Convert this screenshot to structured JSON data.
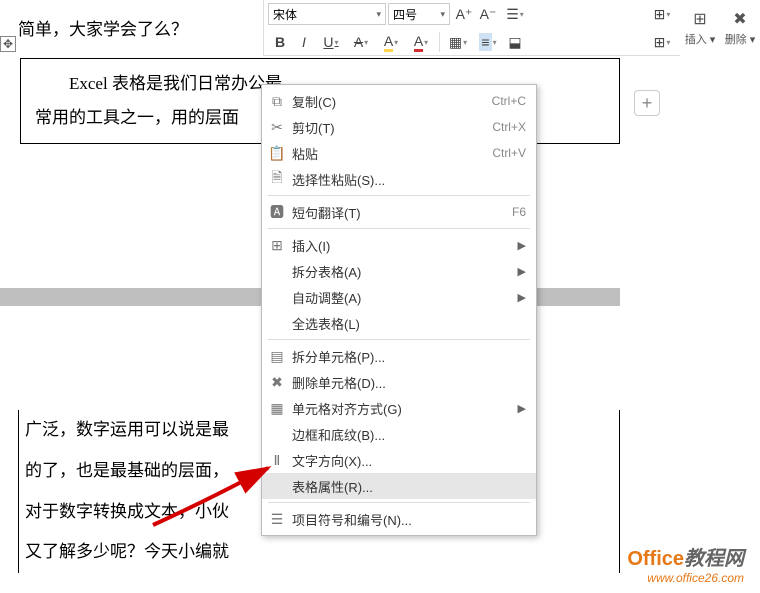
{
  "toolbar": {
    "font_family": "宋体",
    "font_size": "四号",
    "increase_font": "A⁺",
    "decrease_font": "A⁻",
    "bold": "B",
    "italic": "I",
    "underline": "U",
    "strike": "A",
    "highlight": "A",
    "font_color": "A",
    "insert_label": "插入",
    "delete_label": "删除"
  },
  "document": {
    "line_above": "简单，大家学会了么？",
    "table_cell": "Excel 表格是我们日常办公最常用的工具之一，用的层面",
    "table_row1": "Excel 表格是我们日常办公最",
    "table_row2": "常用的工具之一，用的层面",
    "lower_lines": [
      "广泛，数字运用可以说是最",
      "的了，也是最基础的层面，",
      "对于数字转换成文本，小伙",
      "又了解多少呢？今天小编就"
    ]
  },
  "context_menu": {
    "items": [
      {
        "icon": "copy",
        "label": "复制(C)",
        "shortcut": "Ctrl+C"
      },
      {
        "icon": "cut",
        "label": "剪切(T)",
        "shortcut": "Ctrl+X"
      },
      {
        "icon": "paste",
        "label": "粘贴",
        "shortcut": "Ctrl+V"
      },
      {
        "icon": "paste-special",
        "label": "选择性粘贴(S)...",
        "shortcut": ""
      },
      {
        "icon": "translate",
        "label": "短句翻译(T)",
        "shortcut": "F6"
      },
      {
        "icon": "insert",
        "label": "插入(I)",
        "submenu": true
      },
      {
        "icon": "",
        "label": "拆分表格(A)",
        "submenu": true
      },
      {
        "icon": "",
        "label": "自动调整(A)",
        "submenu": true
      },
      {
        "icon": "",
        "label": "全选表格(L)",
        "shortcut": ""
      },
      {
        "icon": "split-cell",
        "label": "拆分单元格(P)...",
        "shortcut": ""
      },
      {
        "icon": "delete-cell",
        "label": "删除单元格(D)...",
        "shortcut": ""
      },
      {
        "icon": "align",
        "label": "单元格对齐方式(G)",
        "submenu": true
      },
      {
        "icon": "",
        "label": "边框和底纹(B)...",
        "shortcut": ""
      },
      {
        "icon": "text-dir",
        "label": "文字方向(X)...",
        "shortcut": ""
      },
      {
        "icon": "",
        "label": "表格属性(R)...",
        "shortcut": "",
        "hover": true
      },
      {
        "icon": "bullets",
        "label": "项目符号和编号(N)...",
        "shortcut": ""
      }
    ]
  },
  "watermark": {
    "brand": "Office",
    "suffix": "教程网",
    "url": "www.office26.com"
  },
  "icons": {
    "plus": "+",
    "cross_arrows": "✥"
  }
}
